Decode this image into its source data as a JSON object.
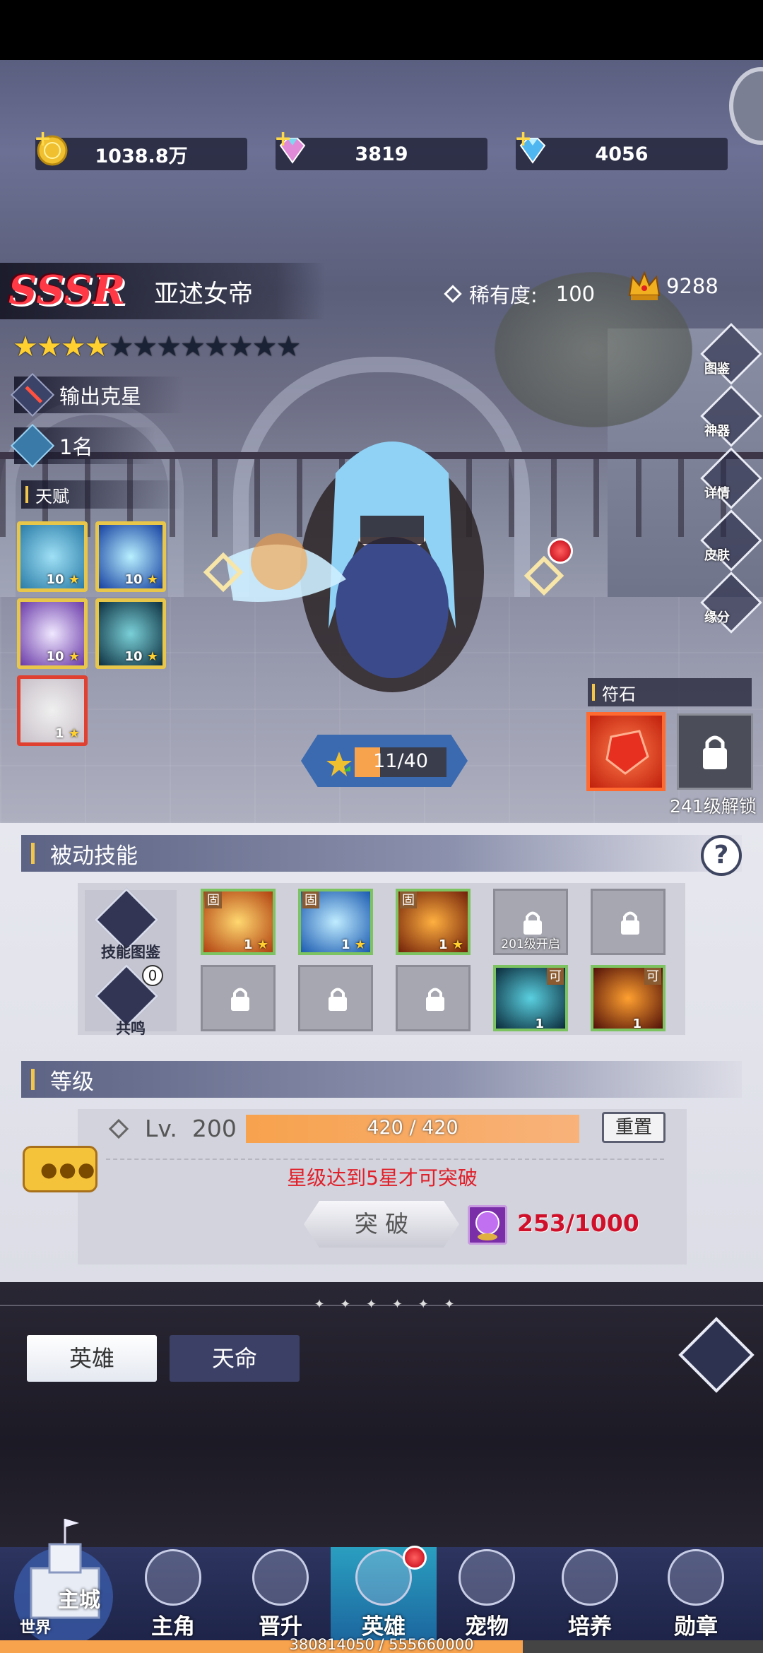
{
  "resources": [
    {
      "name": "gold",
      "value": "1038.8万"
    },
    {
      "name": "rainbow-diamond",
      "value": "3819"
    },
    {
      "name": "blue-diamond",
      "value": "4056"
    }
  ],
  "hero": {
    "rarity_label": "SSSR",
    "name": "亚述女帝",
    "rarity_label_text": "稀有度:",
    "rarity_value": "100",
    "power": "9288",
    "stars_filled": 4,
    "stars_total": 12,
    "role": "输出克星",
    "rank": "1名"
  },
  "talent": {
    "title": "天赋",
    "items": [
      {
        "level": "10"
      },
      {
        "level": "10"
      },
      {
        "level": "10"
      },
      {
        "level": "10"
      },
      {
        "level": "1"
      }
    ]
  },
  "side_menu": [
    "图鉴",
    "神器",
    "详情",
    "皮肤",
    "缘分"
  ],
  "exp": {
    "current": 11,
    "max": 40,
    "text": "11/40"
  },
  "rune": {
    "title": "符石",
    "unlock_text": "241级解锁"
  },
  "passive": {
    "title": "被动技能",
    "help": "?",
    "codex_label": "技能图鉴",
    "resonance_label": "共鸣",
    "resonance_count": "0",
    "row1": [
      {
        "tag": "固",
        "level": "1",
        "color": "#c86a10"
      },
      {
        "tag": "固",
        "level": "1",
        "color": "#2a7fd8"
      },
      {
        "tag": "固",
        "level": "1",
        "color": "#a84a10"
      },
      {
        "locked": true,
        "text": "201级开启"
      },
      {
        "locked": true,
        "text": ""
      }
    ],
    "row2": [
      {
        "locked": true
      },
      {
        "locked": true
      },
      {
        "locked": true
      },
      {
        "tag": "可",
        "level": "1",
        "color": "#1d6aa0"
      },
      {
        "tag": "可",
        "level": "1",
        "color": "#b83a10"
      }
    ]
  },
  "level": {
    "title": "等级",
    "lv_label": "Lv.",
    "lv_value": "200",
    "exp_text": "420 / 420",
    "exp_fraction": 1.0,
    "reset_label": "重置",
    "warning": "星级达到5星才可突破",
    "breakthrough_label": "突 破",
    "material_text": "253/1000"
  },
  "tabs": {
    "hero": "英雄",
    "destiny": "天命"
  },
  "nav": {
    "home_top": "主城",
    "home_bottom": "世界",
    "items": [
      "主角",
      "晋升",
      "英雄",
      "宠物",
      "培养",
      "勋章"
    ],
    "active_index": 2,
    "progress_text": "380814050 / 555660000",
    "progress_fraction": 0.685
  },
  "colors": {
    "accent": "#f2c64a",
    "sssr": "#ff3a46",
    "warning": "#e0202a",
    "exp_bar": "#f7a24d",
    "material": "#d0102a"
  }
}
